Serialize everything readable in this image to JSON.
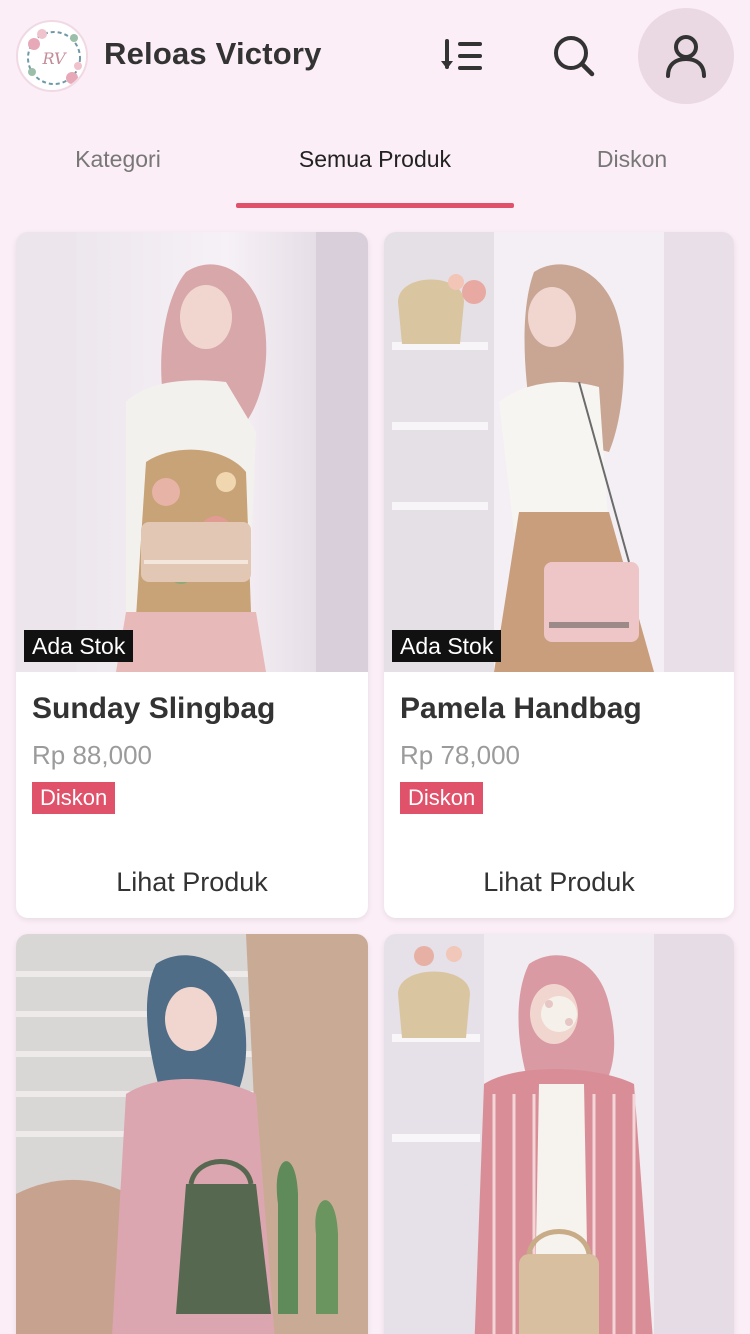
{
  "header": {
    "title": "Reloas Victory",
    "logo_text": "RV",
    "icons": {
      "sort": "sort-list-icon",
      "search": "search-icon",
      "profile": "user-icon"
    }
  },
  "tabs": [
    {
      "label": "Kategori",
      "active": false
    },
    {
      "label": "Semua Produk",
      "active": true
    },
    {
      "label": "Diskon",
      "active": false
    }
  ],
  "colors": {
    "accent": "#e0516a",
    "background": "#fbeef6"
  },
  "products": [
    {
      "name": "Sunday Slingbag",
      "price": "Rp 88,000",
      "stock": "Ada Stok",
      "badge": "Diskon",
      "action": "Lihat Produk"
    },
    {
      "name": "Pamela Handbag",
      "price": "Rp 78,000",
      "stock": "Ada Stok",
      "badge": "Diskon",
      "action": "Lihat Produk"
    },
    {
      "name": "",
      "price": "",
      "stock": "",
      "badge": "",
      "action": ""
    },
    {
      "name": "",
      "price": "",
      "stock": "",
      "badge": "",
      "action": ""
    }
  ]
}
